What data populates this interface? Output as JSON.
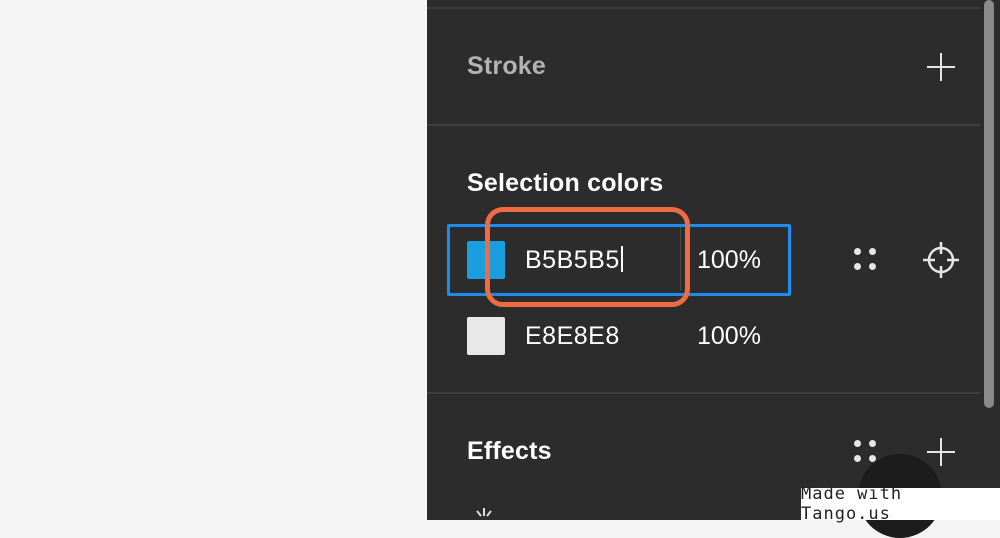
{
  "panel": {
    "stroke": {
      "title": "Stroke"
    },
    "selection_colors": {
      "title": "Selection colors",
      "rows": [
        {
          "hex": "B5B5B5",
          "opacity": "100%",
          "swatch_color": "#1a9ee0",
          "selected": true
        },
        {
          "hex": "E8E8E8",
          "opacity": "100%",
          "swatch_color": "#e8e8e8",
          "selected": false
        }
      ]
    },
    "effects": {
      "title": "Effects"
    }
  },
  "colors": {
    "panel_bg": "#2c2c2c",
    "selection_border": "#1d8bf0",
    "highlight": "#ef6b43"
  },
  "watermark": {
    "text": "Made with Tango.us"
  }
}
